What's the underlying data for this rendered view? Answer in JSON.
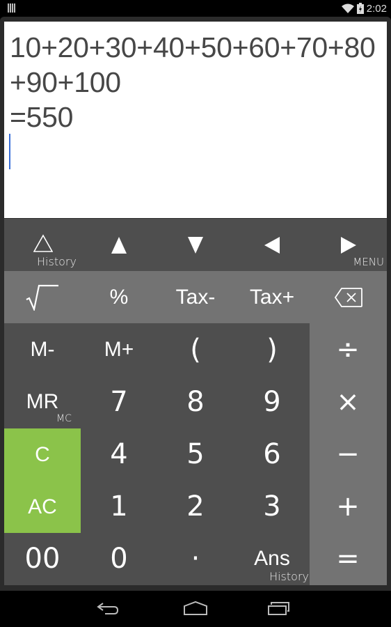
{
  "status_bar": {
    "notification_icon": "storage-bars-icon",
    "wifi_icon": "wifi-icon",
    "battery_icon": "battery-charging-icon",
    "time": "2:02"
  },
  "display": {
    "expression": "10+20+30+40+50+60+70+80+90+100",
    "result": "=550"
  },
  "nav_row": [
    {
      "name": "history-button",
      "icon": "triangle-outline-up-icon",
      "sub": "History"
    },
    {
      "name": "cursor-up-button",
      "icon": "triangle-up-icon",
      "sub": ""
    },
    {
      "name": "cursor-down-button",
      "icon": "triangle-down-icon",
      "sub": ""
    },
    {
      "name": "cursor-left-button",
      "icon": "triangle-left-icon",
      "sub": ""
    },
    {
      "name": "cursor-right-button",
      "icon": "triangle-right-icon",
      "sub": "MENU"
    }
  ],
  "function_row": {
    "sqrt": "√",
    "percent": "%",
    "tax_minus": "Tax-",
    "tax_plus": "Tax+",
    "backspace_icon": "backspace-icon"
  },
  "keys": {
    "m_minus": "M-",
    "m_plus": "M+",
    "paren_open": "(",
    "paren_close": ")",
    "mr": "MR",
    "mr_sub": "MC",
    "seven": "7",
    "eight": "8",
    "nine": "9",
    "clear": "C",
    "four": "4",
    "five": "5",
    "six": "6",
    "all_clear": "AC",
    "one": "1",
    "two": "2",
    "three": "3",
    "double_zero": "00",
    "zero": "0",
    "decimal": "·",
    "ans": "Ans",
    "ans_sub": "History"
  },
  "operators": {
    "divide": "÷",
    "multiply": "×",
    "subtract": "−",
    "add": "+",
    "equals": "="
  },
  "colors": {
    "clear_key_green": "#8bc34a",
    "key_dark": "#4e4e4e",
    "key_light": "#737373",
    "caret_blue": "#3a6fd8"
  },
  "system_nav": {
    "back_icon": "back-icon",
    "home_icon": "home-icon",
    "recents_icon": "recents-icon"
  }
}
